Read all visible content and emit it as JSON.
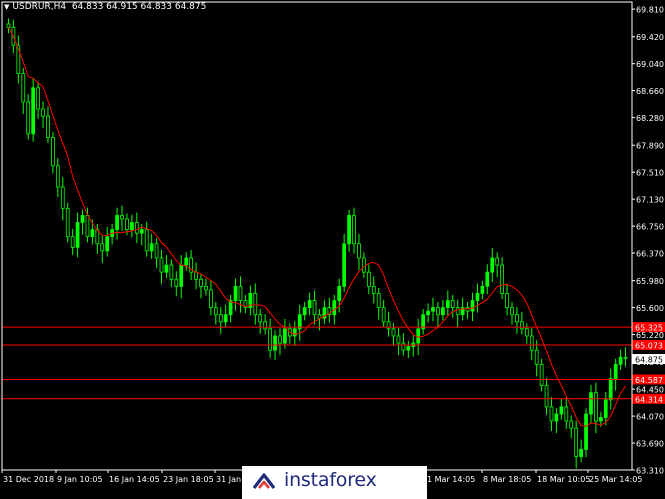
{
  "header": {
    "symbol": "USDRUR,H4",
    "ohlc": "64.833 64.915 64.833 64.875"
  },
  "watermark": {
    "brand": "instaforex"
  },
  "colors": {
    "background": "#000000",
    "frame": "#ffffff",
    "bull_candle": "#00ff00",
    "moving_average": "#ff0000",
    "level_line": "#ff0000",
    "level_tag_bg": "#ff0000",
    "price_tag_bg": "#ffffff"
  },
  "chart_data": {
    "type": "candlestick",
    "title": "USDRUR,H4",
    "ylim": [
      63.31,
      69.91
    ],
    "y_ticks": [
      "69.810",
      "69.420",
      "69.040",
      "68.660",
      "68.280",
      "67.890",
      "67.510",
      "67.130",
      "66.750",
      "66.370",
      "65.980",
      "65.600",
      "65.220",
      "64.840",
      "64.450",
      "64.070",
      "63.690",
      "63.310"
    ],
    "x_ticks": [
      "31 Dec 2018",
      "9 Jan 10:05",
      "16 Jan 14:05",
      "23 Jan 18:05",
      "31 Jan",
      "1 Mar 14:05",
      "8 Mar 18:05",
      "18 Mar 10:05",
      "25 Mar 14:05"
    ],
    "current_price": "64.875",
    "levels": [
      "65.325",
      "65.073",
      "64.587",
      "64.314"
    ],
    "moving_average": "red line",
    "closes": [
      69.55,
      69.3,
      68.9,
      68.5,
      68.05,
      68.7,
      68.4,
      68.3,
      68.0,
      67.6,
      67.3,
      67.0,
      66.6,
      66.45,
      66.8,
      66.9,
      66.6,
      66.7,
      66.5,
      66.4,
      66.6,
      66.7,
      66.9,
      66.85,
      66.7,
      66.8,
      66.65,
      66.7,
      66.4,
      66.5,
      66.3,
      66.1,
      66.2,
      66.0,
      65.9,
      66.2,
      66.3,
      66.1,
      66.0,
      65.9,
      65.85,
      65.6,
      65.5,
      65.4,
      65.5,
      65.7,
      65.9,
      65.7,
      65.6,
      65.8,
      65.5,
      65.4,
      65.3,
      65.0,
      65.2,
      65.1,
      65.3,
      65.2,
      65.3,
      65.5,
      65.6,
      65.7,
      65.5,
      65.45,
      65.6,
      65.5,
      65.7,
      65.9,
      66.5,
      66.9,
      66.5,
      66.3,
      66.1,
      65.9,
      65.8,
      65.6,
      65.4,
      65.3,
      65.2,
      65.1,
      65.0,
      65.05,
      65.1,
      65.3,
      65.5,
      65.55,
      65.6,
      65.5,
      65.6,
      65.7,
      65.6,
      65.5,
      65.6,
      65.55,
      65.7,
      65.8,
      65.9,
      66.1,
      66.3,
      66.2,
      65.8,
      65.6,
      65.5,
      65.4,
      65.3,
      65.2,
      65.0,
      64.8,
      64.5,
      64.2,
      64.0,
      64.1,
      64.2,
      64.0,
      63.9,
      63.5,
      63.6,
      64.1,
      64.4,
      64.0,
      64.05,
      64.3,
      64.6,
      64.8,
      64.9,
      64.88
    ]
  }
}
